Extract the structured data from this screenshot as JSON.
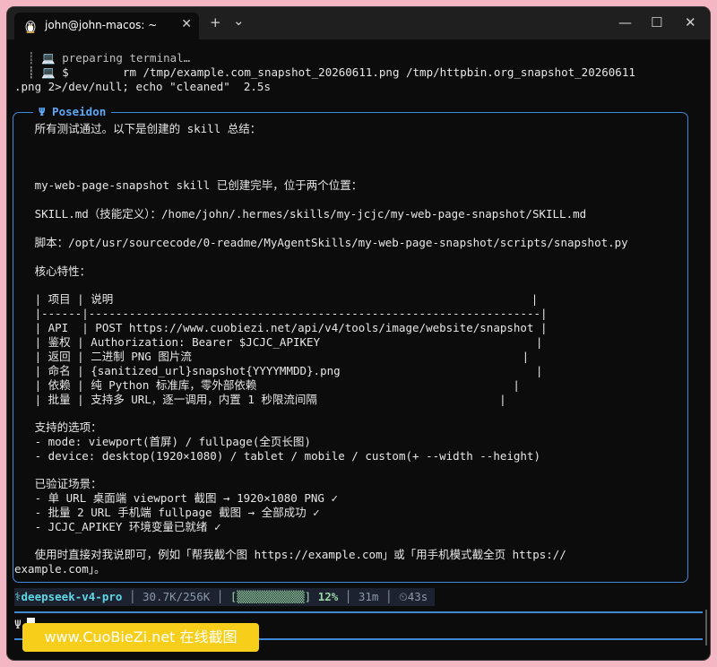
{
  "titlebar": {
    "tab_title": "john@john-macos: ~",
    "close_tab_glyph": "✕",
    "new_tab_glyph": "+",
    "dropdown_glyph": "⌄",
    "minimize_glyph": "—",
    "maximize_glyph": "☐",
    "close_glyph": "✕"
  },
  "terminal": {
    "lines": [
      "  ┊ 💻 preparing terminal…",
      "  ┊ 💻 $        rm /tmp/example.com_snapshot_20260611.png /tmp/httpbin.org_snapshot_20260611",
      ".png 2>/dev/null; echo \"cleaned\"  2.5s"
    ]
  },
  "box": {
    "title": "Ψ Poseidon",
    "lines": [
      "   所有测试通过。以下是创建的 skill 总结：",
      "",
      "",
      "",
      "   my-web-page-snapshot skill 已创建完毕，位于两个位置：",
      "",
      "   SKILL.md（技能定义）：/home/john/.hermes/skills/my-jcjc/my-web-page-snapshot/SKILL.md",
      "",
      "   脚本：/opt/usr/sourcecode/0-readme/MyAgentSkills/my-web-page-snapshot/scripts/snapshot.py",
      "",
      "   核心特性：",
      "",
      "   | 项目 | 说明                                                              |",
      "   |------|-------------------------------------------------------------------|",
      "   | API  | POST https://www.cuobiezi.net/api/v4/tools/image/website/snapshot |",
      "   | 鉴权 | Authorization: Bearer $JCJC_APIKEY                                |",
      "   | 返回 | 二进制 PNG 图片流                                                 |",
      "   | 命名 | {sanitized_url}snapshot{YYYYMMDD}.png                             |",
      "   | 依赖 | 纯 Python 标准库，零外部依赖                                      |",
      "   | 批量 | 支持多 URL，逐一调用，内置 1 秒限流间隔                           |",
      "",
      "   支持的选项：",
      "   - mode: viewport(首屏) / fullpage(全页长图)",
      "   - device: desktop(1920×1080) / tablet / mobile / custom(+ --width --height)",
      "",
      "   已验证场景：",
      "   - 单 URL 桌面端 viewport 截图 → 1920×1080 PNG ✓",
      "   - 批量 2 URL 手机端 fullpage 截图 → 全部成功 ✓",
      "   - JCJC_APIKEY 环境变量已就绪 ✓",
      "",
      "   使用时直接对我说即可，例如「帮我截个图 https://example.com」或「用手机模式截全页 https://",
      "example.com」。"
    ]
  },
  "status": {
    "model": "⚕deepseek-v4-pro",
    "sep": " │ ",
    "tokens": "30.7K/256K",
    "bar": "[▒▒▒▒▒▒▒▒▒▒]",
    "percent": "12%",
    "elapsed": "31m",
    "timer": "⏲43s"
  },
  "prompt": {
    "symbol": "Ψ"
  },
  "watermark": "www.CuoBieZi.net 在线截图",
  "colors": {
    "background": "#0c0c0c",
    "accent": "#3f88d8",
    "text": "#e6e6e6",
    "page": "#f4b6c2"
  }
}
